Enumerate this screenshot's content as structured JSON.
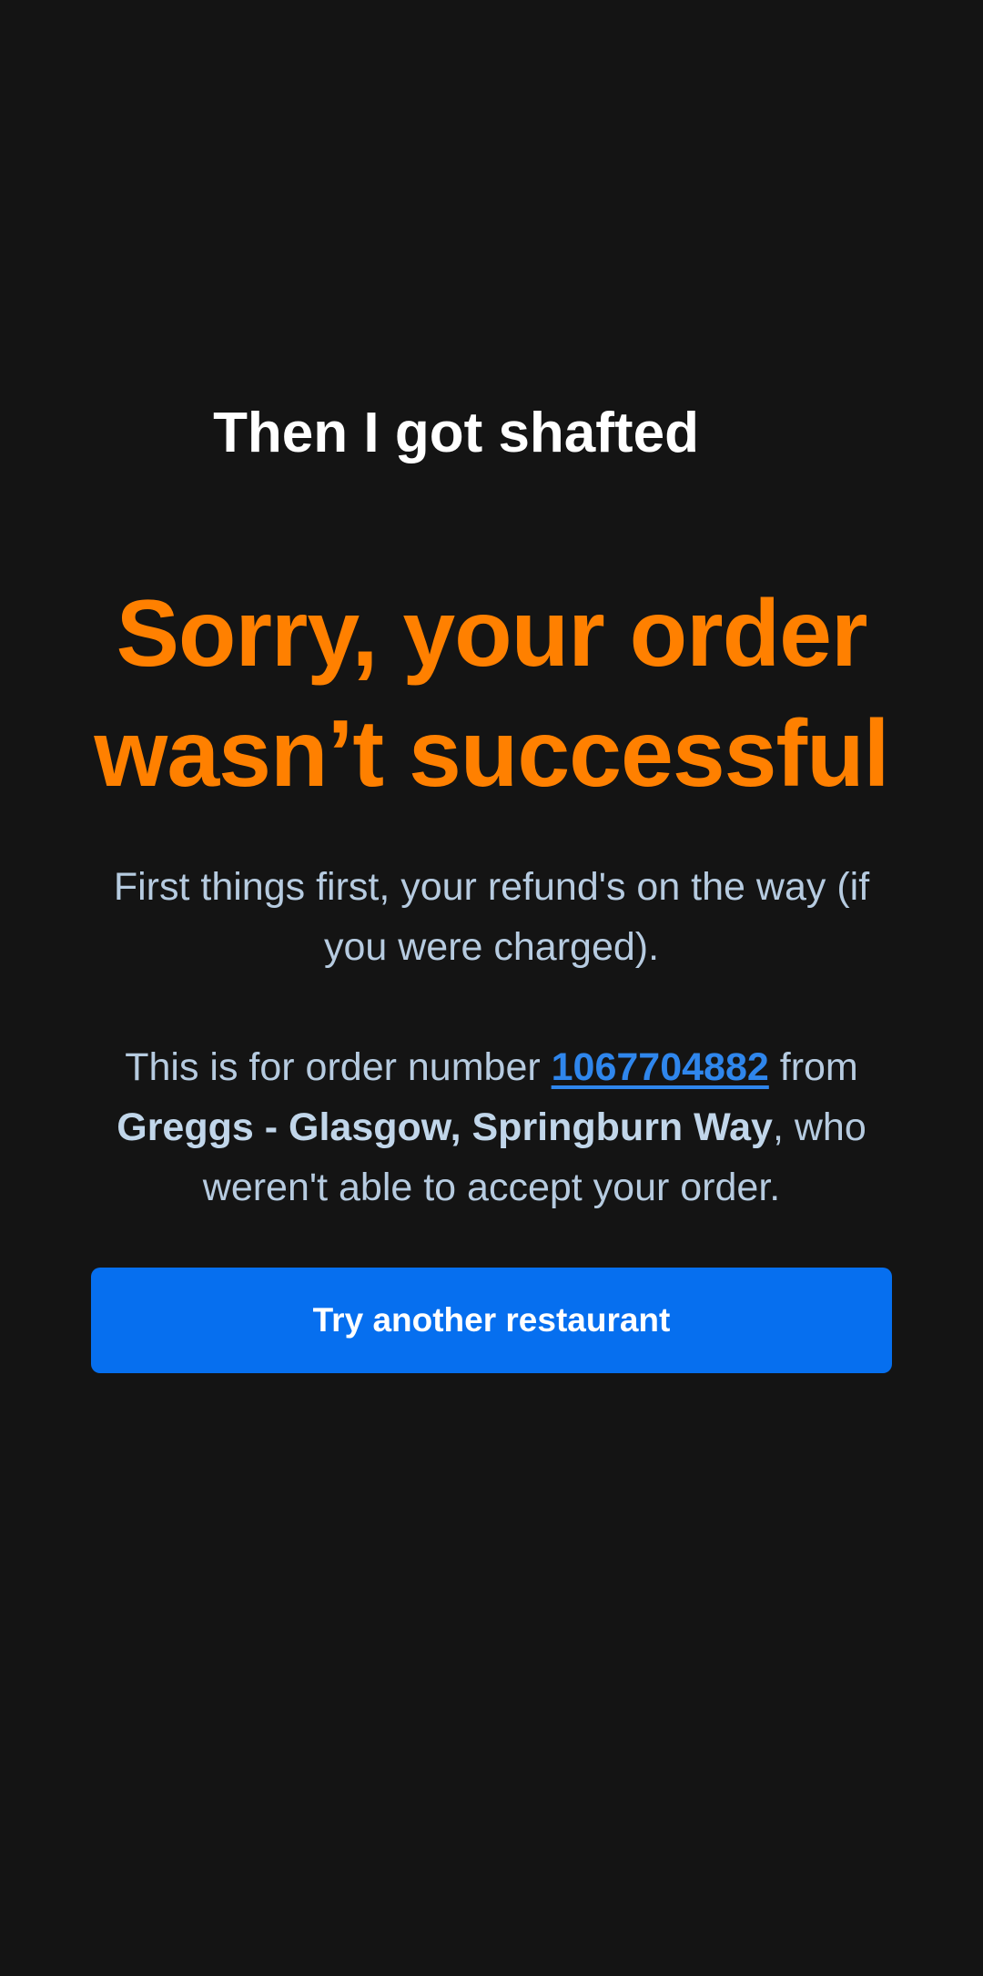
{
  "caption": "Then I got shafted",
  "headline": "Sorry, your order wasn’t successful",
  "refund_message": "First things first, your refund's on the way (if you were charged).",
  "order_info": {
    "prefix": "This is for order number",
    "order_number": "1067704882",
    "from": "from",
    "restaurant": "Greggs - Glasgow, Springburn Way",
    "suffix": ", who weren't able to accept your order."
  },
  "cta_label": "Try another restaurant",
  "colors": {
    "background": "#141414",
    "headline": "#ff8000",
    "body_text": "#b6cbe0",
    "link": "#2f86ec",
    "button": "#066fef"
  }
}
